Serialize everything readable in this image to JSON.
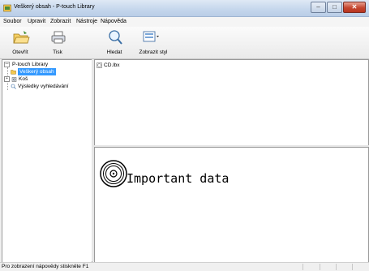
{
  "window": {
    "title": "Veškerý obsah - P-touch Library"
  },
  "menu": [
    "Soubor",
    "Upravit",
    "Zobrazit",
    "Nástroje",
    "Nápověda"
  ],
  "toolbar": {
    "open": "Otevřít",
    "print": "Tisk",
    "search": "Hledat",
    "view_style": "Zobrazit styl"
  },
  "tree": {
    "root": "P-touch Library",
    "all_contents": "Veškerý obsah",
    "recycle": "Koš",
    "search_results": "Výsledky vyhledávání"
  },
  "files": [
    {
      "name": "CD.lbx"
    }
  ],
  "preview": {
    "text": "Important data"
  },
  "status": {
    "text": "Pro zobrazení nápovědy stiskněte F1"
  }
}
